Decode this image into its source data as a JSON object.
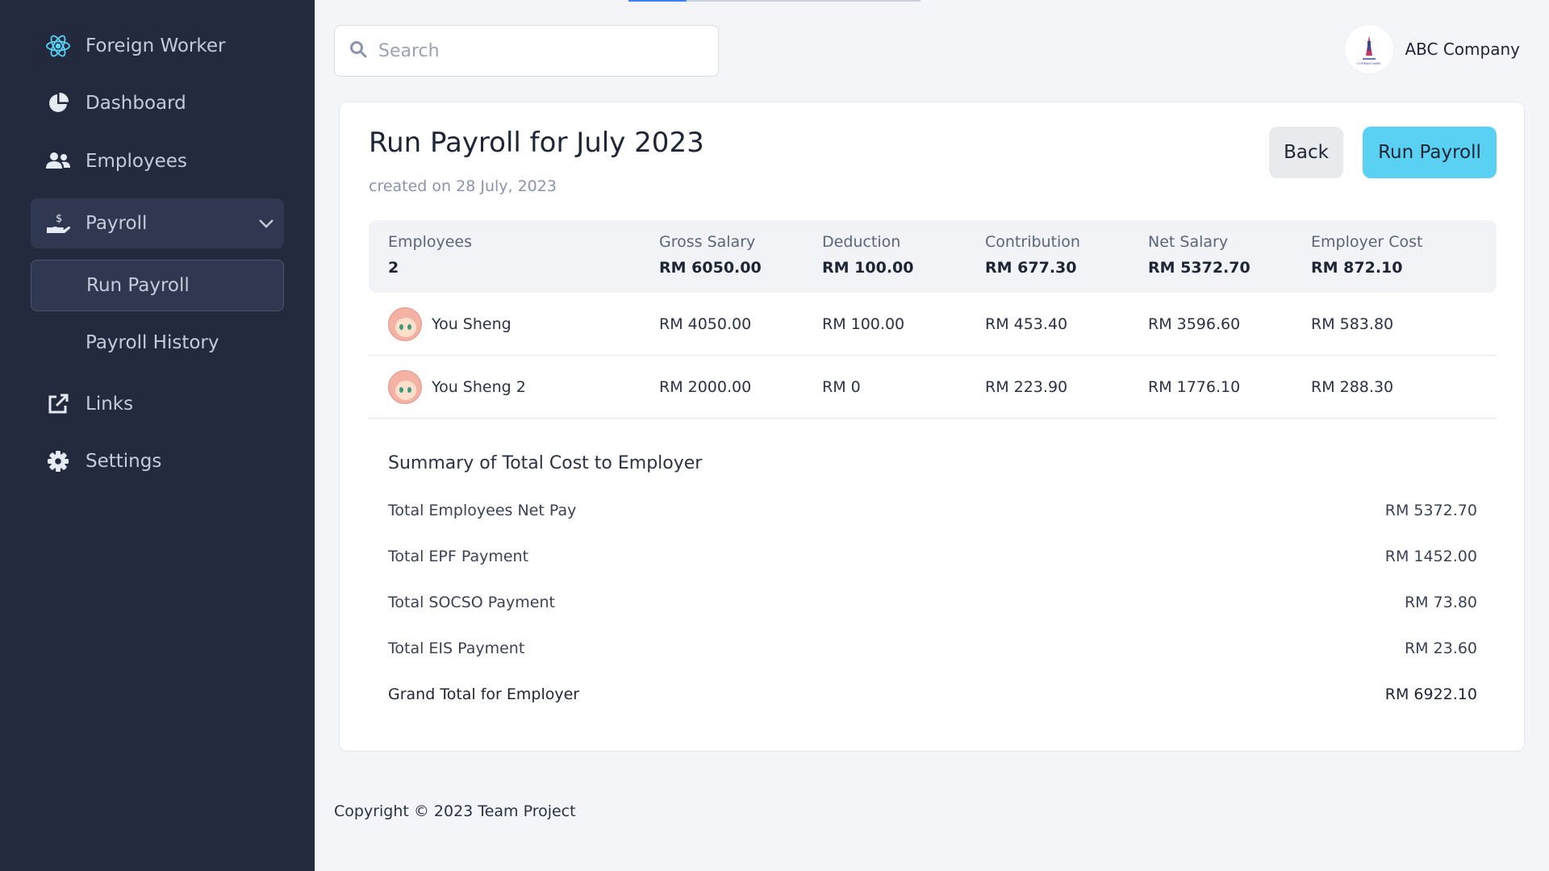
{
  "sidebar": {
    "brand": "Foreign Worker",
    "items": [
      {
        "label": "Dashboard"
      },
      {
        "label": "Employees"
      },
      {
        "label": "Payroll"
      },
      {
        "label": "Links"
      },
      {
        "label": "Settings"
      }
    ],
    "payroll_sub": [
      {
        "label": "Run Payroll"
      },
      {
        "label": "Payroll History"
      }
    ]
  },
  "search": {
    "placeholder": "Search"
  },
  "header": {
    "company": "ABC Company",
    "logo_text": "COMPANY NAME"
  },
  "page": {
    "title": "Run Payroll for July 2023",
    "subtitle": "created on 28 July, 2023",
    "back_label": "Back",
    "run_label": "Run Payroll"
  },
  "totals": {
    "employees_label": "Employees",
    "employees_value": "2",
    "gross_label": "Gross Salary",
    "gross_value": "RM 6050.00",
    "deduction_label": "Deduction",
    "deduction_value": "RM 100.00",
    "contribution_label": "Contribution",
    "contribution_value": "RM 677.30",
    "net_label": "Net Salary",
    "net_value": "RM 5372.70",
    "employer_label": "Employer Cost",
    "employer_value": "RM 872.10"
  },
  "employees": [
    {
      "name": "You Sheng",
      "gross": "RM 4050.00",
      "deduction": "RM 100.00",
      "contribution": "RM 453.40",
      "net": "RM 3596.60",
      "employer": "RM 583.80"
    },
    {
      "name": "You Sheng 2",
      "gross": "RM 2000.00",
      "deduction": "RM 0",
      "contribution": "RM 223.90",
      "net": "RM 1776.10",
      "employer": "RM 288.30"
    }
  ],
  "summary": {
    "title": "Summary of Total Cost to Employer",
    "rows": [
      {
        "label": "Total Employees Net Pay",
        "value": "RM 5372.70"
      },
      {
        "label": "Total EPF Payment",
        "value": "RM 1452.00"
      },
      {
        "label": "Total SOCSO Payment",
        "value": "RM 73.80"
      },
      {
        "label": "Total EIS Payment",
        "value": "RM 23.60"
      },
      {
        "label": "Grand Total for Employer",
        "value": "RM 6922.10"
      }
    ]
  },
  "footer": {
    "text": "Copyright © 2023 Team Project"
  },
  "colors": {
    "sidebar": "#232a3e",
    "accent": "#5ad0f3",
    "indicator": "#3b82f6"
  }
}
